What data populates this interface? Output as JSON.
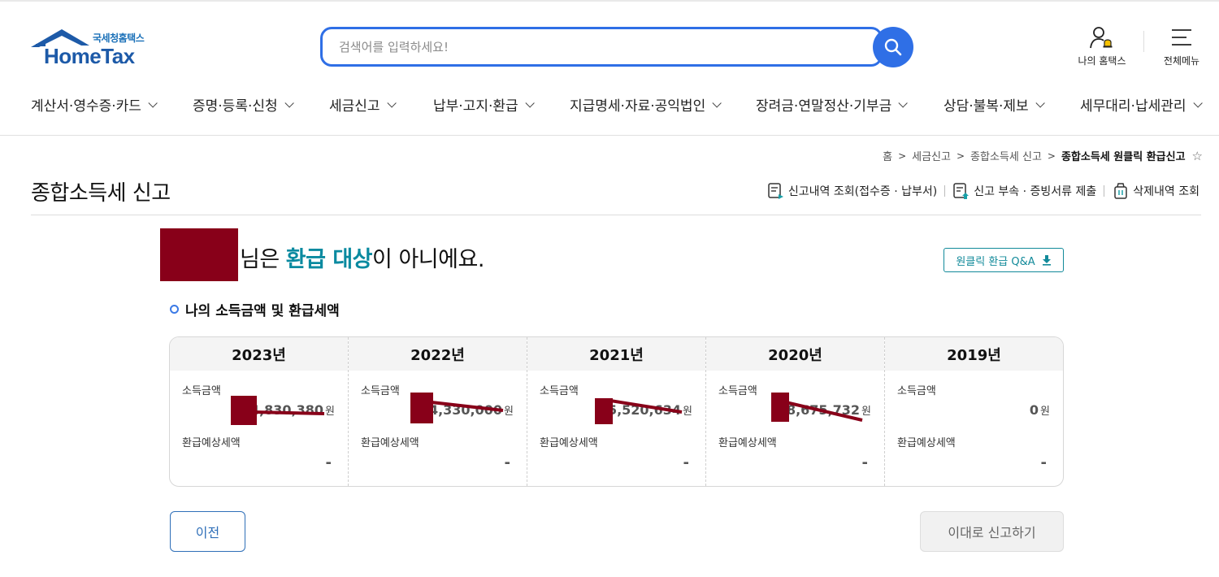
{
  "header": {
    "logo_sub": "국세청홈택스",
    "logo_main": "HomeTax",
    "search_placeholder": "검색어를 입력하세요!",
    "my_hometax": "나의 홈택스",
    "full_menu": "전체메뉴",
    "accent": "#2f6fe6"
  },
  "gnb": [
    {
      "label": "계산서·영수증·카드"
    },
    {
      "label": "증명·등록·신청"
    },
    {
      "label": "세금신고"
    },
    {
      "label": "납부·고지·환급"
    },
    {
      "label": "지급명세·자료·공익법인"
    },
    {
      "label": "장려금·연말정산·기부금"
    },
    {
      "label": "상담·불복·제보"
    },
    {
      "label": "세무대리·납세관리"
    }
  ],
  "breadcrumb": {
    "home": "홈",
    "level1": "세금신고",
    "level2": "종합소득세 신고",
    "current": "종합소득세 원클릭 환급신고"
  },
  "page": {
    "title": "종합소득세 신고",
    "links": [
      "신고내역 조회(접수증 · 납부서)",
      "신고 부속 · 증빙서류 제출",
      "삭제내역 조회"
    ]
  },
  "result": {
    "suffix": "님은 ",
    "highlight": "환급 대상",
    "tail": "이 아니에요.",
    "qa_button": "원클릭 환급 Q&A",
    "highlight_color": "#0a8aa0"
  },
  "section": {
    "title": "나의 소득금액 및 환급세액"
  },
  "cards": [
    {
      "year": "2023년",
      "income_label": "소득금액",
      "income": "4,830,380",
      "won": "원",
      "refund_label": "환급예상세액",
      "refund": "-"
    },
    {
      "year": "2022년",
      "income_label": "소득금액",
      "income": "4,330,000",
      "won": "원",
      "refund_label": "환급예상세액",
      "refund": "-"
    },
    {
      "year": "2021년",
      "income_label": "소득금액",
      "income": "5,520,634",
      "won": "원",
      "refund_label": "환급예상세액",
      "refund": "-"
    },
    {
      "year": "2020년",
      "income_label": "소득금액",
      "income": "8,675,732",
      "won": "원",
      "refund_label": "환급예상세액",
      "refund": "-"
    },
    {
      "year": "2019년",
      "income_label": "소득금액",
      "income": "0",
      "won": "원",
      "refund_label": "환급예상세액",
      "refund": "-"
    }
  ],
  "buttons": {
    "prev": "이전",
    "submit": "이대로 신고하기"
  },
  "redaction_color": "#880019"
}
